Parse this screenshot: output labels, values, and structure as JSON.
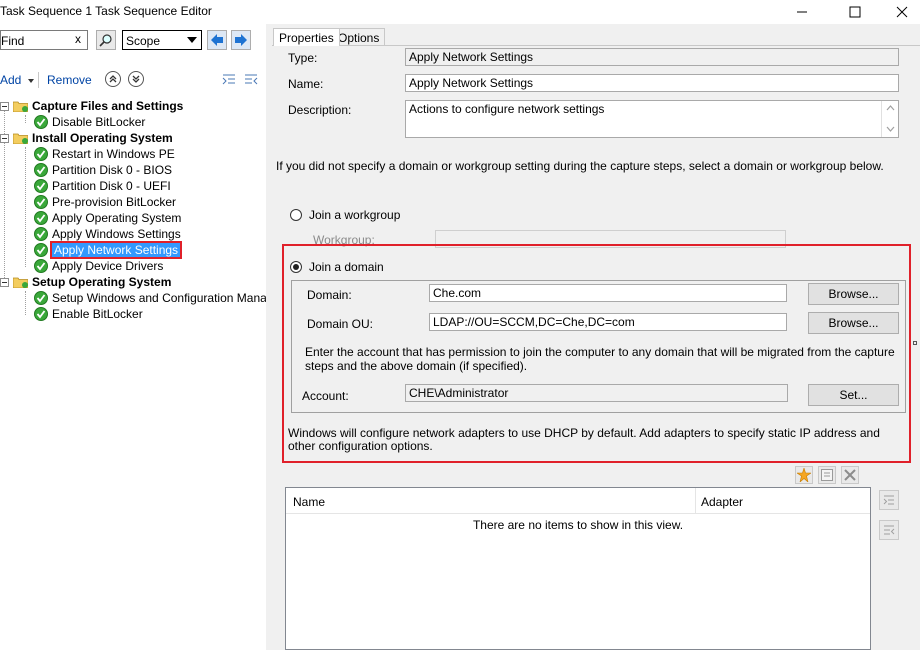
{
  "window": {
    "title": "Task Sequence 1 Task Sequence Editor"
  },
  "toolbar": {
    "find_value": "Find",
    "find_clear": "x",
    "scope_value": "Scope",
    "add_label": "Add",
    "remove_label": "Remove"
  },
  "tree": {
    "groups": [
      {
        "label": "Capture Files and Settings",
        "items": [
          "Disable BitLocker"
        ]
      },
      {
        "label": "Install Operating System",
        "items": [
          "Restart in Windows PE",
          "Partition Disk 0 - BIOS",
          "Partition Disk 0 - UEFI",
          "Pre-provision BitLocker",
          "Apply Operating System",
          "Apply Windows Settings",
          "Apply Network Settings",
          "Apply Device Drivers"
        ]
      },
      {
        "label": "Setup Operating System",
        "items": [
          "Setup Windows and Configuration Manager",
          "Enable BitLocker"
        ]
      }
    ],
    "selected": "Apply Network Settings"
  },
  "tabs": [
    {
      "label": "Properties",
      "active": true
    },
    {
      "label": "Options",
      "active": false
    }
  ],
  "properties": {
    "type_label": "Type:",
    "type_value": "Apply Network Settings",
    "name_label": "Name:",
    "name_value": "Apply Network Settings",
    "description_label": "Description:",
    "description_value": "Actions to configure network settings",
    "instruction": "If you did not specify a domain or workgroup setting during the capture steps, select a domain or workgroup below.",
    "workgroup_radio": "Join a workgroup",
    "workgroup_label": "Workgroup:",
    "workgroup_value": "",
    "domain_radio": "Join a domain",
    "domain_label": "Domain:",
    "domain_value": "Che.com",
    "browse_label": "Browse...",
    "domain_ou_label": "Domain OU:",
    "domain_ou_value": "LDAP://OU=SCCM,DC=Che,DC=com",
    "account_note": "Enter the account that has permission to join the computer to any domain that will be migrated from the capture steps and the above domain (if specified).",
    "account_label": "Account:",
    "account_value": "CHE\\Administrator",
    "set_label": "Set...",
    "dhcp_note": "Windows will configure network adapters to use DHCP by default. Add adapters to specify static IP address and other configuration options."
  },
  "adapters": {
    "columns": [
      "Name",
      "Adapter"
    ],
    "empty_message": "There are no items to show in this view."
  },
  "colors": {
    "highlight": "#e0202a",
    "selection": "#3399ff",
    "check_green": "#3aa83a"
  }
}
